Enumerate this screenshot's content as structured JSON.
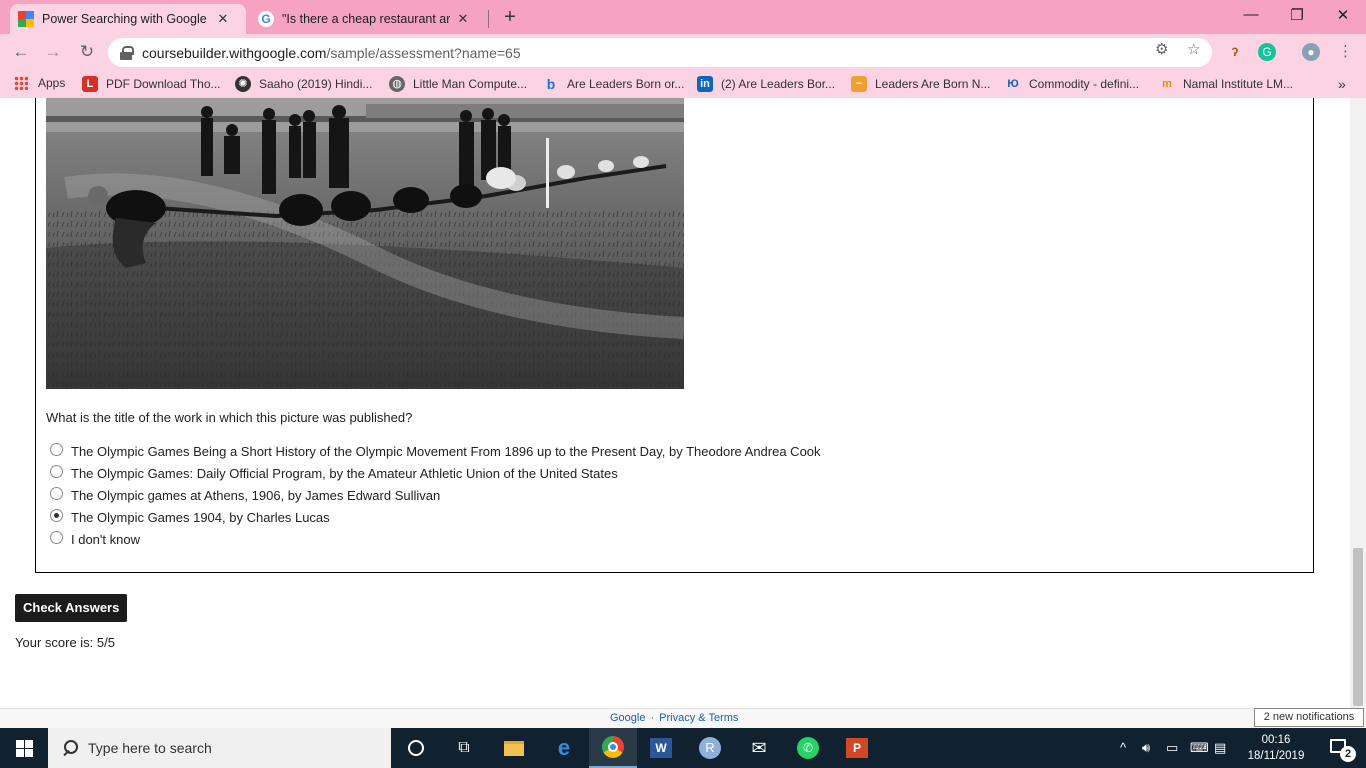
{
  "browser": {
    "tabs": [
      {
        "title": "Power Searching with Google - ",
        "favicon": "coursebuilder-icon",
        "active": true
      },
      {
        "title": "\"Is there a cheap restaurant arou",
        "favicon": "google-g-icon",
        "active": false
      }
    ],
    "url_host": "coursebuilder.withgoogle.com",
    "url_path": "/sample/assessment?name=65",
    "bookmarks": [
      {
        "label": "Apps",
        "icon": "apps-grid-icon"
      },
      {
        "label": "PDF Download Tho...",
        "icon": "pdf-icon"
      },
      {
        "label": "Saaho (2019) Hindi...",
        "icon": "film-reel-icon"
      },
      {
        "label": "Little Man Compute...",
        "icon": "globe-icon"
      },
      {
        "label": "Are Leaders Born or...",
        "icon": "bing-icon"
      },
      {
        "label": "(2) Are Leaders Bor...",
        "icon": "linkedin-icon"
      },
      {
        "label": "Leaders Are Born N...",
        "icon": "site-icon"
      },
      {
        "label": "Commodity - defini...",
        "icon": "dictionary-icon"
      },
      {
        "label": "Namal Institute LM...",
        "icon": "moodle-icon"
      }
    ],
    "theme_color": "#f5a3c0"
  },
  "assessment": {
    "question": "What is the title of the work in which this picture was published?",
    "options": [
      {
        "label": "The Olympic Games Being a Short History of the Olympic Movement From 1896 up to the Present Day, by Theodore Andrea Cook",
        "checked": false
      },
      {
        "label": "The Olympic Games: Daily Official Program, by the Amateur Athletic Union of the United States",
        "checked": false
      },
      {
        "label": "The Olympic games at Athens, 1906, by James Edward Sullivan",
        "checked": false
      },
      {
        "label": "The Olympic Games 1904, by Charles Lucas",
        "checked": true
      },
      {
        "label": "I don't know",
        "checked": false
      }
    ],
    "check_button": "Check Answers",
    "score_text": "Your score is: 5/5"
  },
  "footer": {
    "google": "Google",
    "separator": "·",
    "privacy": "Privacy & Terms"
  },
  "notification_tooltip": "2 new notifications",
  "taskbar": {
    "search_placeholder": "Type here to search",
    "time": "00:16",
    "date": "18/11/2019",
    "notification_count": "2"
  }
}
